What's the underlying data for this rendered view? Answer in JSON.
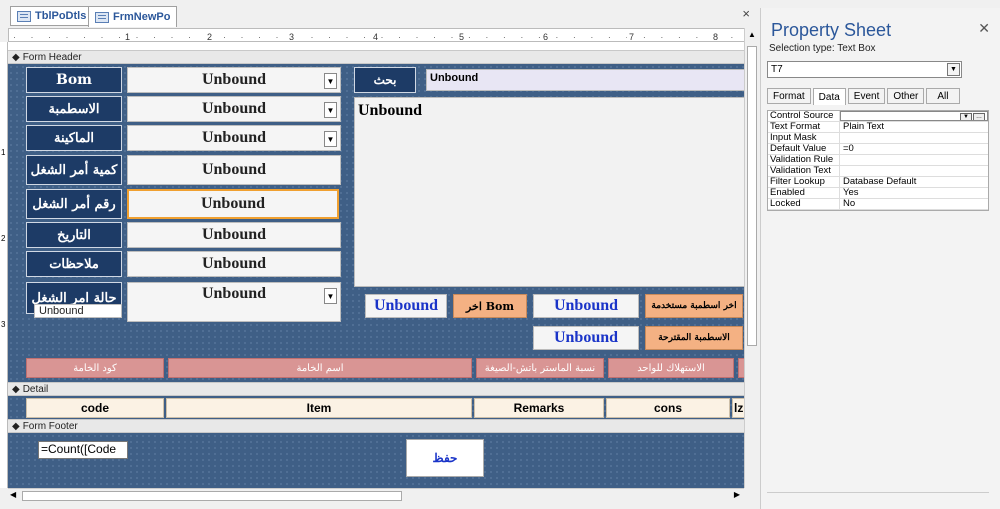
{
  "tabs": [
    {
      "label": "TblPoDtls"
    },
    {
      "label": "FrmNewPo"
    }
  ],
  "doc_close": "×",
  "ruler": {
    "marks": [
      "1",
      "2",
      "3",
      "4",
      "5",
      "6",
      "7",
      "8"
    ],
    "vmarks": [
      "1",
      "2",
      "3"
    ]
  },
  "sections": {
    "header": "Form Header",
    "detail": "Detail",
    "footer": "Form Footer"
  },
  "header_labels": [
    "Bom",
    "الاسطمبة",
    "الماكينة",
    "كمية أمر الشغل",
    "رقم أمر الشغل",
    "التاريخ",
    "ملاحظات",
    "حالة امر الشغل"
  ],
  "unbound": "Unbound",
  "unbound_small": "Unbound",
  "search_button": "بحث",
  "search_field": "Unbound",
  "memo_field": "Unbound",
  "right_controls": {
    "used_label": "اخر اسطمبة مستخدمة",
    "last_bom_label": "اخر Bom",
    "suggested_label": "الاسطمبة المقترحة"
  },
  "columns_header": [
    "كود الخامة",
    "اسم الخامة",
    "نسبة الماستر باتش-الصيغة",
    "الاستهلاك للواحد"
  ],
  "columns_detail": [
    "code",
    "Item",
    "Remarks",
    "cons",
    "lz"
  ],
  "footer": {
    "count_field": "=Count([Code",
    "save_button": "حفظ"
  },
  "property_sheet": {
    "title": "Property Sheet",
    "selection": "Selection type:  Text Box",
    "object": "T7",
    "tabs": [
      "Format",
      "Data",
      "Event",
      "Other",
      "All"
    ],
    "active_tab": "Data",
    "rows": [
      {
        "k": "Control Source",
        "v": ""
      },
      {
        "k": "Text Format",
        "v": "Plain Text"
      },
      {
        "k": "Input Mask",
        "v": ""
      },
      {
        "k": "Default Value",
        "v": "=0"
      },
      {
        "k": "Validation Rule",
        "v": ""
      },
      {
        "k": "Validation Text",
        "v": ""
      },
      {
        "k": "Filter Lookup",
        "v": "Database Default"
      },
      {
        "k": "Enabled",
        "v": "Yes"
      },
      {
        "k": "Locked",
        "v": "No"
      }
    ]
  },
  "colors": {
    "grid": "#3f5f86",
    "label": "#1d3b66",
    "accent": "#2b579a",
    "pink": "#d99594",
    "orange": "#f4b183"
  }
}
